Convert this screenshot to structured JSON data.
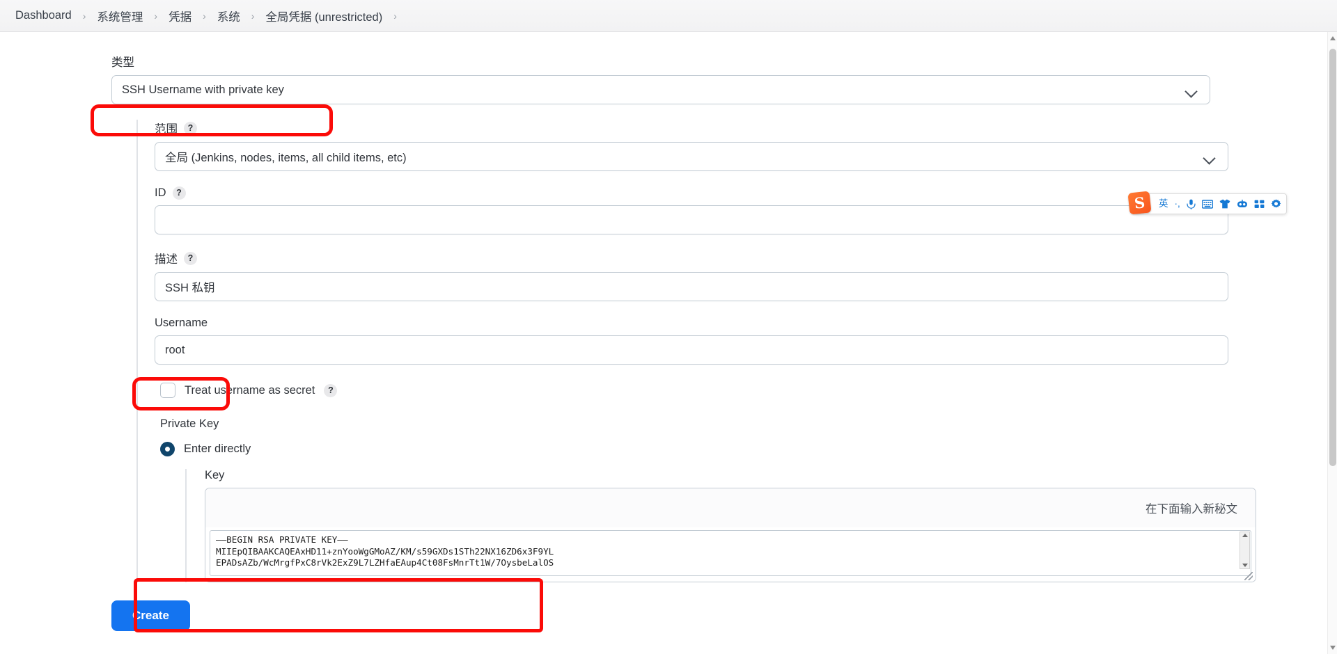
{
  "breadcrumb": {
    "items": [
      {
        "label": "Dashboard"
      },
      {
        "label": "系统管理"
      },
      {
        "label": "凭据"
      },
      {
        "label": "系统"
      },
      {
        "label": "全局凭据 (unrestricted)"
      }
    ],
    "separator": "›"
  },
  "form": {
    "type": {
      "label": "类型",
      "value": "SSH Username with private key"
    },
    "scope": {
      "label": "范围",
      "help": "?",
      "value": "全局 (Jenkins, nodes, items, all child items, etc)"
    },
    "id": {
      "label": "ID",
      "help": "?",
      "value": ""
    },
    "description": {
      "label": "描述",
      "help": "?",
      "value": "SSH 私钥"
    },
    "username": {
      "label": "Username",
      "value": "root"
    },
    "treat_secret": {
      "label": "Treat username as secret",
      "help": "?",
      "checked": false
    },
    "private_key": {
      "section_label": "Private Key",
      "radio_label": "Enter directly",
      "key_label": "Key",
      "secret_hint": "在下面输入新秘文",
      "key_value": "——BEGIN RSA PRIVATE KEY——\nMIIEpQIBAAKCAQEAxHD11+znYooWgGMoAZ/KM/s59GXDs1STh22NX16ZD6x3F9YL\nEPADsAZb/WcMrgfPxC8rVk2ExZ9L7LZHfaEAup4Ct08FsMnrTt1W/7OysbeLalOS"
    },
    "submit": {
      "label": "Create"
    }
  },
  "ime": {
    "logo": "S",
    "items": [
      {
        "name": "language-english-icon",
        "glyph": "英"
      },
      {
        "name": "punctuation-icon",
        "glyph": "·,"
      },
      {
        "name": "microphone-icon",
        "glyph": ""
      },
      {
        "name": "keyboard-icon",
        "glyph": ""
      },
      {
        "name": "skin-icon",
        "glyph": ""
      },
      {
        "name": "robot-icon",
        "glyph": ""
      },
      {
        "name": "apps-grid-icon",
        "glyph": ""
      },
      {
        "name": "settings-gear-icon",
        "glyph": ""
      }
    ]
  },
  "colors": {
    "accent_blue": "#1474f0",
    "annotation_red": "#fb0b08",
    "radio_selected": "#10456b",
    "ime_orange": "#f8541d",
    "ime_blue": "#1478d4"
  }
}
